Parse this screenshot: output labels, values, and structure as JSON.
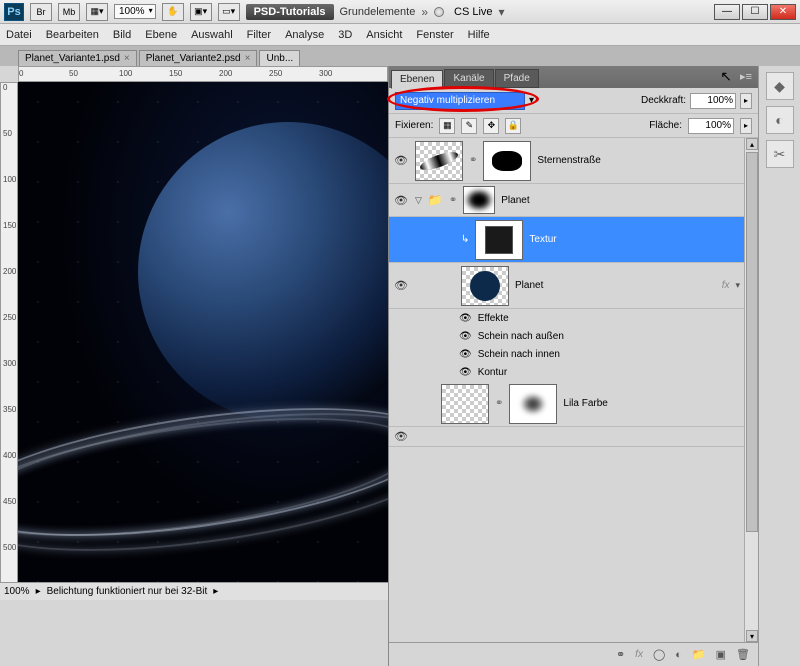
{
  "titlebar": {
    "zoom": "100%",
    "psd_tutorials": "PSD-Tutorials",
    "workspace": "Grundelemente",
    "cslive": "CS Live"
  },
  "menu": [
    "Datei",
    "Bearbeiten",
    "Bild",
    "Ebene",
    "Auswahl",
    "Filter",
    "Analyse",
    "3D",
    "Ansicht",
    "Fenster",
    "Hilfe"
  ],
  "doc_tabs": [
    "Planet_Variante1.psd",
    "Planet_Variante2.psd",
    "Unb..."
  ],
  "ruler_top": [
    "0",
    "50",
    "100",
    "150",
    "200",
    "250",
    "300"
  ],
  "ruler_left": [
    "0",
    "50",
    "100",
    "150",
    "200",
    "250",
    "300",
    "350",
    "400",
    "450",
    "500"
  ],
  "status": {
    "zoom": "100%",
    "msg": "Belichtung funktioniert nur bei 32-Bit"
  },
  "panel": {
    "tabs": [
      "Ebenen",
      "Kanäle",
      "Pfade"
    ],
    "blend_mode": "Negativ multiplizieren",
    "opacity_label": "Deckkraft:",
    "opacity": "100%",
    "lock_label": "Fixieren:",
    "fill_label": "Fläche:",
    "fill": "100%"
  },
  "layers": [
    {
      "name": "Sternenstraße"
    },
    {
      "name": "Planet"
    },
    {
      "name": "Textur"
    },
    {
      "name": "Planet"
    },
    {
      "effects_label": "Effekte",
      "fx": [
        "Schein nach außen",
        "Schein nach innen",
        "Kontur"
      ]
    },
    {
      "name": "Lila Farbe"
    }
  ],
  "fx_label": "fx"
}
